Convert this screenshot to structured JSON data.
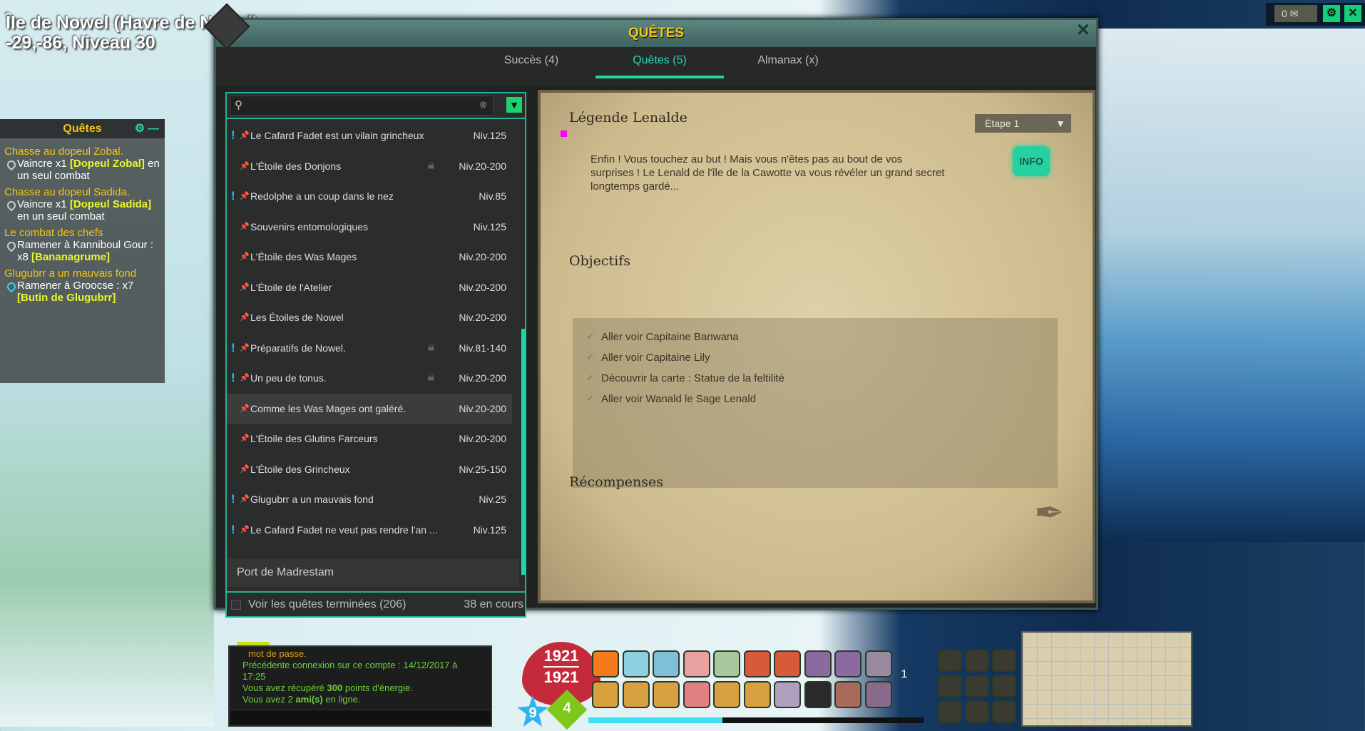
{
  "map": {
    "title_line1": "Île de Nowel (Havre de Nowel)",
    "title_line2": "-29,-86, Niveau 30"
  },
  "topbar": {
    "mail_count": "0"
  },
  "tracker": {
    "title": "Quêtes",
    "quests": [
      {
        "title": "Chasse au dopeul Zobal.",
        "obj_prefix": "Vaincre x1 ",
        "obj_item": "[Dopeul Zobal]",
        "obj_suffix": " en un seul combat"
      },
      {
        "title": "Chasse au dopeul Sadida.",
        "obj_prefix": "Vaincre x1 ",
        "obj_item": "[Dopeul Sadida]",
        "obj_suffix": " en un seul combat"
      },
      {
        "title": "Le combat des chefs",
        "obj_prefix": "Ramener à Kanniboul Gour : x8 ",
        "obj_item": "[Bananagrume]",
        "obj_suffix": ""
      },
      {
        "title": "Glugubrr a un mauvais fond",
        "obj_prefix": "Ramener à Groocse : x7 ",
        "obj_item": "[Butin de Glugubrr]",
        "obj_suffix": ""
      }
    ]
  },
  "window": {
    "title": "QUÊTES",
    "close": "✕",
    "tabs": [
      {
        "label": "Succès (4)"
      },
      {
        "label": "Quêtes (5)"
      },
      {
        "label": "Almanax (x)"
      }
    ],
    "search": {
      "placeholder": ""
    },
    "quests": [
      {
        "name": "Le Cafard Fadet est un vilain grincheux",
        "level": "Niv.125",
        "alert": "!",
        "dungeon": ""
      },
      {
        "name": "L'Étoile des Donjons",
        "level": "Niv.20-200",
        "alert": "",
        "dungeon": "☠"
      },
      {
        "name": "Redolphe a un coup dans le nez",
        "level": "Niv.85",
        "alert": "!",
        "dungeon": ""
      },
      {
        "name": "Souvenirs entomologiques",
        "level": "Niv.125",
        "alert": "",
        "dungeon": ""
      },
      {
        "name": "L'Étoile des Was Mages",
        "level": "Niv.20-200",
        "alert": "",
        "dungeon": ""
      },
      {
        "name": "L'Étoile de l'Atelier",
        "level": "Niv.20-200",
        "alert": "",
        "dungeon": ""
      },
      {
        "name": "Les Étoiles de Nowel",
        "level": "Niv.20-200",
        "alert": "",
        "dungeon": ""
      },
      {
        "name": "Préparatifs de Nowel.",
        "level": "Niv.81-140",
        "alert": "!",
        "dungeon": "☠"
      },
      {
        "name": "Un peu de tonus.",
        "level": "Niv.20-200",
        "alert": "!",
        "dungeon": "☠"
      },
      {
        "name": "Comme les Was Mages ont galéré.",
        "level": "Niv.20-200",
        "alert": "",
        "dungeon": ""
      },
      {
        "name": "L'Étoile des Glutins Farceurs",
        "level": "Niv.20-200",
        "alert": "",
        "dungeon": ""
      },
      {
        "name": "L'Étoile des Grincheux",
        "level": "Niv.25-150",
        "alert": "",
        "dungeon": ""
      },
      {
        "name": "Glugubrr a un mauvais fond",
        "level": "Niv.25",
        "alert": "!",
        "dungeon": ""
      },
      {
        "name": "Le Cafard Fadet ne veut pas rendre l'an ...",
        "level": "Niv.125",
        "alert": "!",
        "dungeon": ""
      }
    ],
    "area_header": "Port de Madrestam",
    "show_finished": "Voir les quêtes terminées (206)",
    "in_progress": "38 en cours",
    "detail": {
      "title": "Légende Lenalde",
      "step": "Étape 1",
      "info": "INFO",
      "description": "Enfin ! Vous touchez au but ! Mais vous n'êtes pas au bout de vos surprises ! Le Lenald de l'île de la Cawotte va vous révéler un grand secret longtemps gardé...",
      "objectives_title": "Objectifs",
      "objectives": [
        "Aller voir Capitaine Banwana",
        "Aller voir Capitaine Lily",
        "Découvrir la carte : Statue de la feltilité",
        "Aller voir Wanald le Sage Lenald"
      ],
      "rewards_title": "Récompenses"
    }
  },
  "chat": {
    "line1": "mot de passe.",
    "line2": "Précédente connexion sur ce compte : 14/12/2017 à 17:25",
    "line3_a": "Vous avez récupéré ",
    "line3_b": "300",
    "line3_c": " points d'énergie.",
    "line4_a": "Vous avez 2 ",
    "line4_b": "ami(s)",
    "line4_c": " en ligne."
  },
  "stats": {
    "hp_current": "1921",
    "hp_max": "1921",
    "ap": "9",
    "mp": "4",
    "shortcut_page": "1",
    "xp_progress_percent": 40
  }
}
